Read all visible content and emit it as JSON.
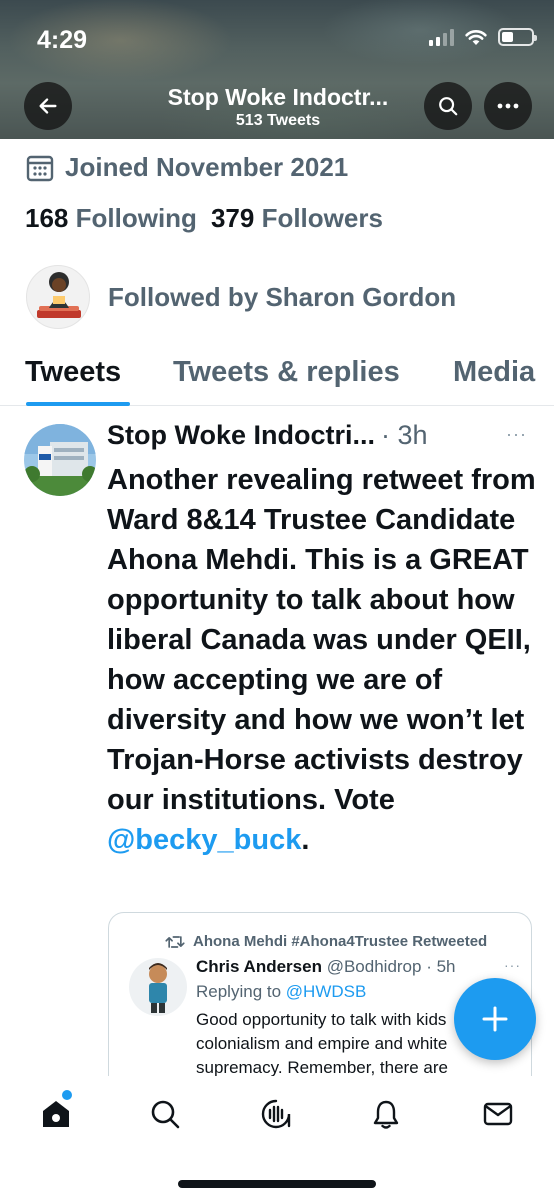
{
  "status_bar": {
    "time": "4:29"
  },
  "header": {
    "title": "Stop Woke Indoctr...",
    "subtitle": "513 Tweets",
    "back_icon": "arrow-left-icon",
    "search_icon": "search-icon",
    "more_icon": "more-horizontal-icon"
  },
  "profile": {
    "joined": "Joined November 2021",
    "following_count": "168",
    "following_label": "Following",
    "followers_count": "379",
    "followers_label": "Followers",
    "followed_by": "Followed by Sharon Gordon"
  },
  "tabs": [
    {
      "label": "Tweets",
      "active": true
    },
    {
      "label": "Tweets & replies",
      "active": false
    },
    {
      "label": "Media",
      "active": false
    }
  ],
  "tweet": {
    "author": "Stop Woke Indoctri...",
    "time": "· 3h",
    "more": "···",
    "text": "Another revealing retweet from Ward 8&14 Trustee Candidate Ahona Mehdi. This is a GREAT opportunity to talk about how liberal Canada was under QEII, how accepting we are of diversity and how we won’t let Trojan-Horse activists destroy our institutions. Vote ",
    "mention": "@becky_buck",
    "text_end": "."
  },
  "quote": {
    "retweeted_by": "Ahona Mehdi #Ahona4Trustee Retweeted",
    "author": "Chris Andersen",
    "handle_time": "@Bodhidrop · 5h",
    "more": "···",
    "replying_label": "Replying to",
    "replying_to": "@HWDSB",
    "body": "Good opportunity to talk with kids colonialism and empire and white supremacy. Remember, there are"
  },
  "nav": {
    "items": [
      "home-icon",
      "search-icon",
      "spaces-icon",
      "notifications-icon",
      "messages-icon"
    ]
  },
  "colors": {
    "accent": "#1d9bf0",
    "text": "#0f1419",
    "muted": "#536471"
  }
}
